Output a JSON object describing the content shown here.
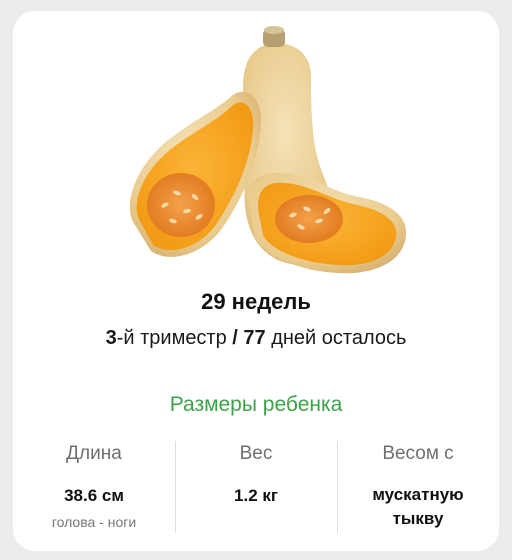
{
  "week": {
    "title": "29 недель"
  },
  "trimester": {
    "number": "3",
    "suffix": "-й триместр",
    "separator": " / ",
    "days_left": "77",
    "days_suffix": " дней осталось"
  },
  "sizes": {
    "section_title": "Размеры ребенка",
    "length": {
      "label": "Длина",
      "value": "38.6 см",
      "note": "голова - ноги"
    },
    "weight": {
      "label": "Вес",
      "value": "1.2 кг"
    },
    "compare": {
      "label": "Весом с",
      "value": "мускатную тыкву"
    }
  },
  "colors": {
    "accent_green": "#3fa14a",
    "pumpkin_skin": "#eccf96",
    "pumpkin_flesh": "#f6a623"
  },
  "illustration": {
    "icon": "butternut-squash-icon"
  }
}
